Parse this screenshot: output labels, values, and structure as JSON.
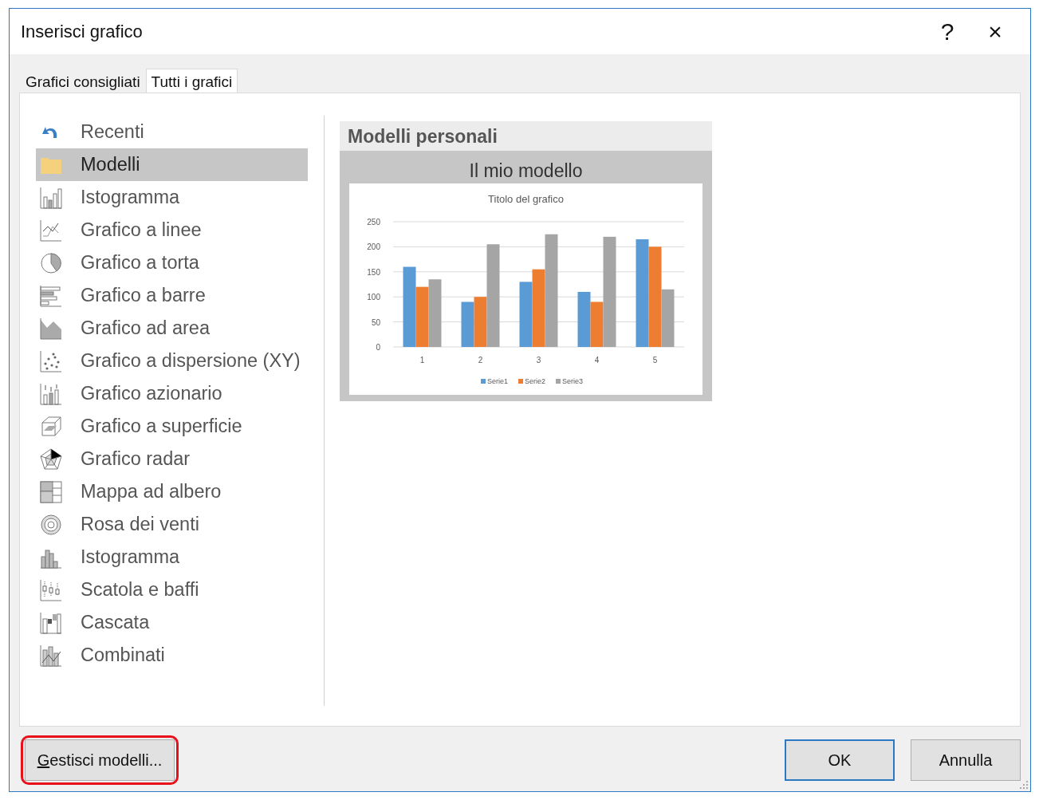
{
  "window": {
    "title": "Inserisci grafico",
    "help": "?",
    "close": "×"
  },
  "tabs": [
    {
      "label": "Grafici consigliati",
      "selected": false
    },
    {
      "label": "Tutti i grafici",
      "selected": true
    }
  ],
  "chart_types": [
    {
      "label": "Recenti",
      "kind": "recent",
      "selected": false
    },
    {
      "label": "Modelli",
      "kind": "folder",
      "selected": true
    },
    {
      "label": "Istogramma",
      "kind": "column",
      "selected": false
    },
    {
      "label": "Grafico a linee",
      "kind": "line",
      "selected": false
    },
    {
      "label": "Grafico a torta",
      "kind": "pie",
      "selected": false
    },
    {
      "label": "Grafico a barre",
      "kind": "bar",
      "selected": false
    },
    {
      "label": "Grafico ad area",
      "kind": "area",
      "selected": false
    },
    {
      "label": "Grafico a dispersione (XY)",
      "kind": "scatter",
      "selected": false
    },
    {
      "label": "Grafico azionario",
      "kind": "stock",
      "selected": false
    },
    {
      "label": "Grafico a superficie",
      "kind": "surface",
      "selected": false
    },
    {
      "label": "Grafico radar",
      "kind": "radar",
      "selected": false
    },
    {
      "label": "Mappa ad albero",
      "kind": "treemap",
      "selected": false
    },
    {
      "label": "Rosa dei venti",
      "kind": "sunburst",
      "selected": false
    },
    {
      "label": "Istogramma",
      "kind": "histogram",
      "selected": false
    },
    {
      "label": "Scatola e baffi",
      "kind": "boxplot",
      "selected": false
    },
    {
      "label": "Cascata",
      "kind": "waterfall",
      "selected": false
    },
    {
      "label": "Combinati",
      "kind": "combo",
      "selected": false
    }
  ],
  "templates": {
    "heading": "Modelli personali",
    "items": [
      {
        "name": "Il mio modello",
        "selected": true,
        "chart_data": {
          "type": "bar",
          "title": "Titolo del grafico",
          "categories": [
            "1",
            "2",
            "3",
            "4",
            "5"
          ],
          "yticks": [
            0,
            50,
            100,
            150,
            200,
            250
          ],
          "ylim": [
            0,
            250
          ],
          "grid": true,
          "legend": true,
          "series": [
            {
              "name": "Serie1",
              "color": "#5b9bd5",
              "values": [
                160,
                90,
                130,
                110,
                215
              ]
            },
            {
              "name": "Serie2",
              "color": "#ed7d31",
              "values": [
                120,
                100,
                155,
                90,
                200
              ]
            },
            {
              "name": "Serie3",
              "color": "#a5a5a5",
              "values": [
                135,
                205,
                225,
                220,
                115
              ]
            }
          ]
        }
      }
    ]
  },
  "buttons": {
    "manage": {
      "label": "Gestisci modelli...",
      "highlighted": true
    },
    "ok": {
      "label": "OK",
      "default": true
    },
    "cancel": {
      "label": "Annulla"
    }
  }
}
